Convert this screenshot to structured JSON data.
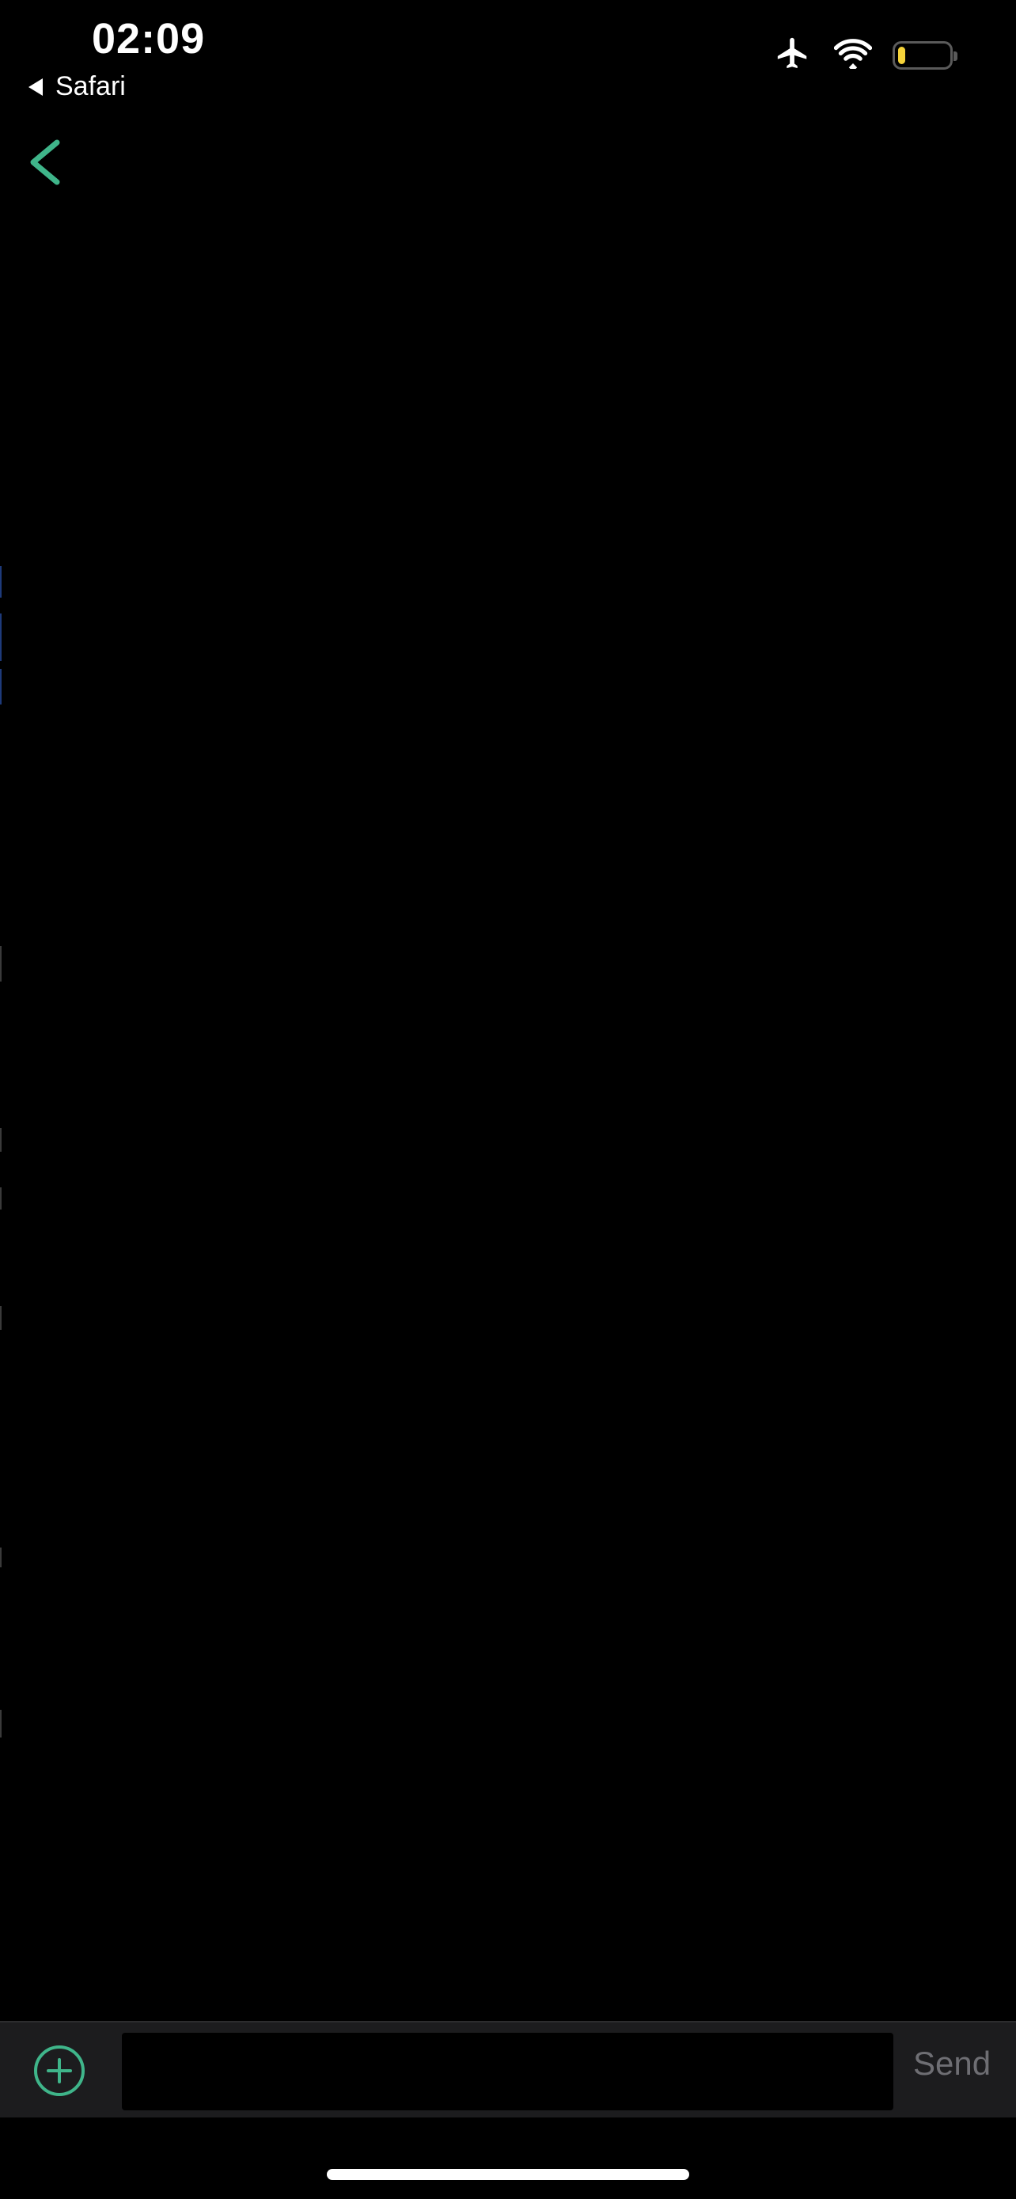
{
  "status_bar": {
    "time": "02:09",
    "back_app_label": "Safari",
    "icons": [
      "airplane-icon",
      "wifi-icon",
      "battery-icon"
    ],
    "battery_level": 0.15,
    "battery_fill_color": "#f5d33a"
  },
  "nav": {
    "back_icon": "chevron-left-icon",
    "accent_color": "#3fb58a"
  },
  "composer": {
    "add_icon": "plus-circle-icon",
    "input_value": "",
    "input_placeholder": "",
    "send_label": "Send"
  }
}
